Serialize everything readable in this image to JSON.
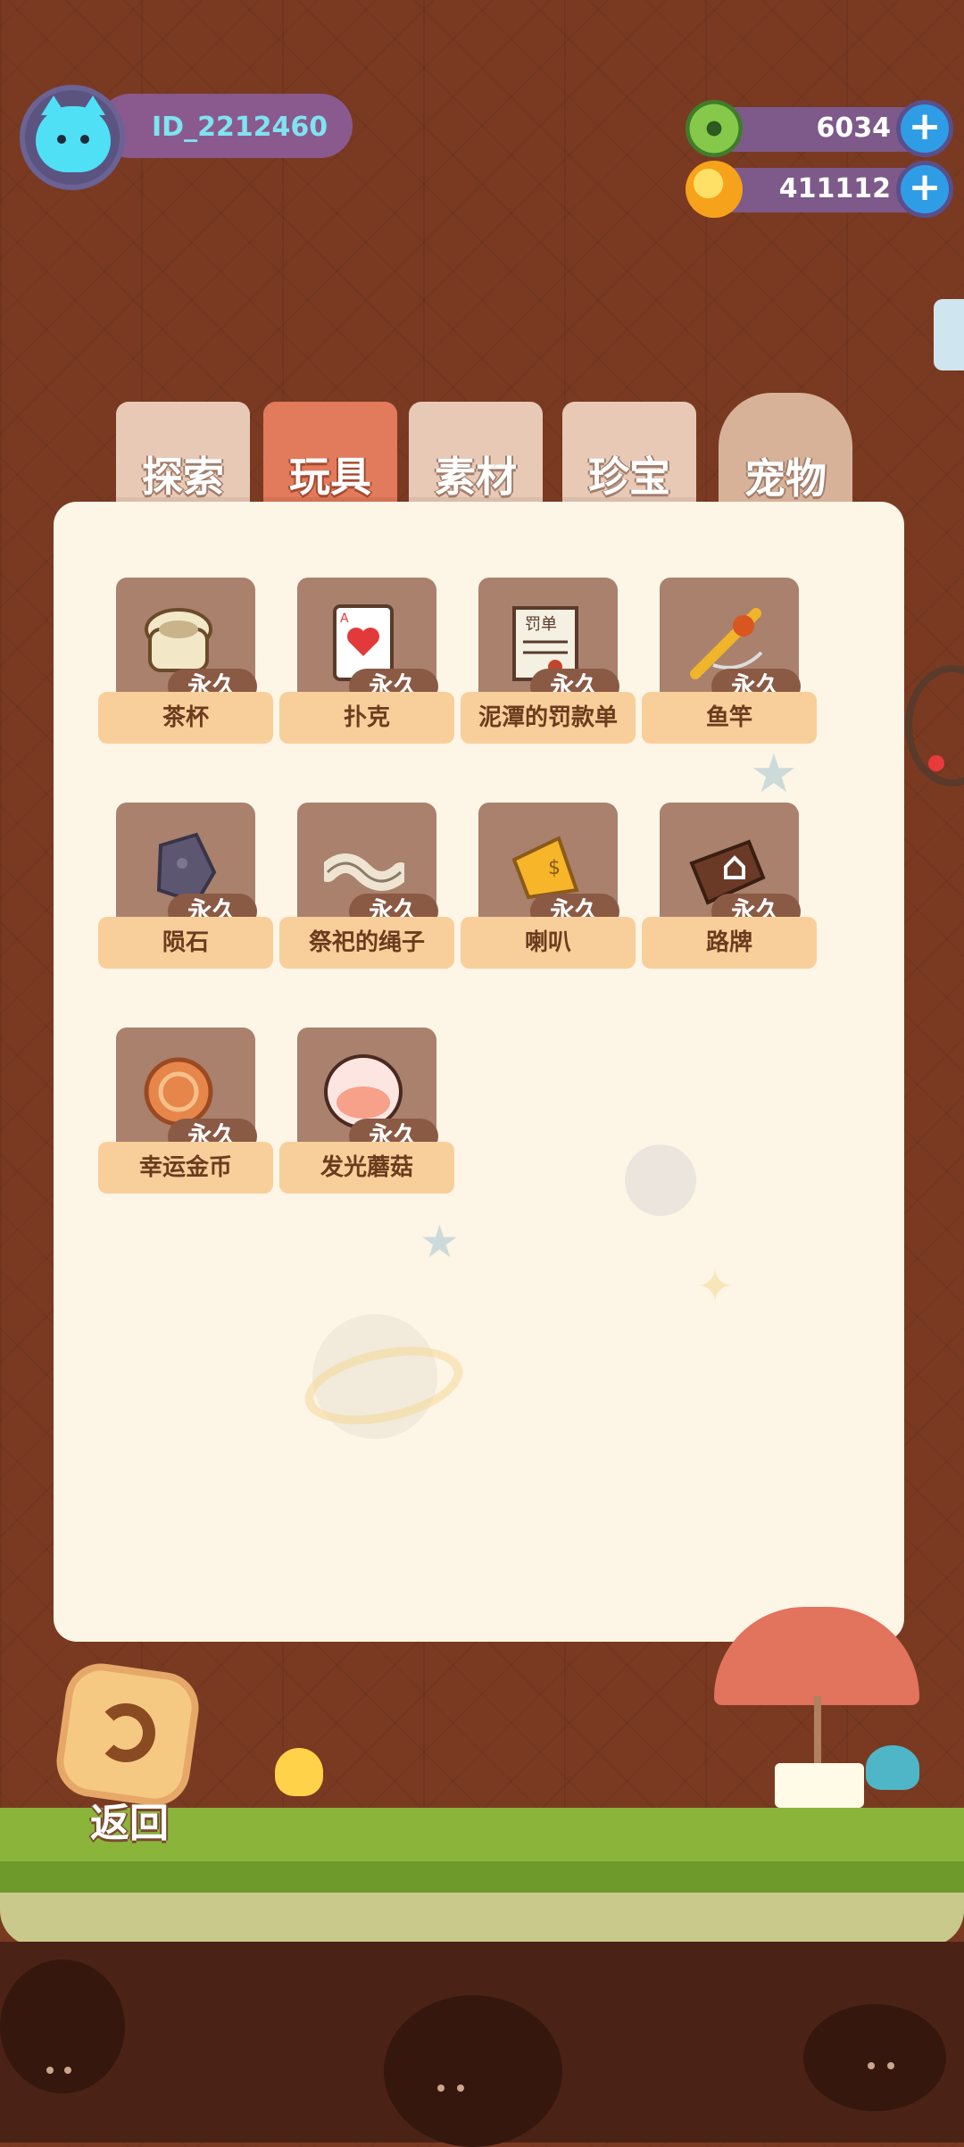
{
  "player": {
    "id": "ID_2212460"
  },
  "currencies": [
    {
      "name": "gem-coin",
      "value": "6034"
    },
    {
      "name": "gold-coin",
      "value": "411112"
    }
  ],
  "tabs": [
    {
      "label": "探索",
      "active": false
    },
    {
      "label": "玩具",
      "active": true
    },
    {
      "label": "素材",
      "active": false
    },
    {
      "label": "珍宝",
      "active": false
    },
    {
      "label": "宠物",
      "active": false
    }
  ],
  "items": [
    {
      "name": "茶杯",
      "badge": "永久",
      "icon": "teacup-icon"
    },
    {
      "name": "扑克",
      "badge": "永久",
      "icon": "playing-card-icon"
    },
    {
      "name": "泥潭的罚款单",
      "badge": "永久",
      "icon": "fine-ticket-icon"
    },
    {
      "name": "鱼竿",
      "badge": "永久",
      "icon": "fishing-rod-icon"
    },
    {
      "name": "陨石",
      "badge": "永久",
      "icon": "meteorite-icon"
    },
    {
      "name": "祭祀的绳子",
      "badge": "永久",
      "icon": "rope-icon"
    },
    {
      "name": "喇叭",
      "badge": "永久",
      "icon": "horn-icon"
    },
    {
      "name": "路牌",
      "badge": "永久",
      "icon": "signpost-icon"
    },
    {
      "name": "幸运金币",
      "badge": "永久",
      "icon": "lucky-coin-icon"
    },
    {
      "name": "发光蘑菇",
      "badge": "永久",
      "icon": "glowing-mushroom-icon"
    }
  ],
  "back_label": "返回",
  "ticket_text": "罚单",
  "colors": {
    "accent_tab": "#e27a5c",
    "panel": "#fdf5e6",
    "label_bg": "#f8cf9a"
  }
}
